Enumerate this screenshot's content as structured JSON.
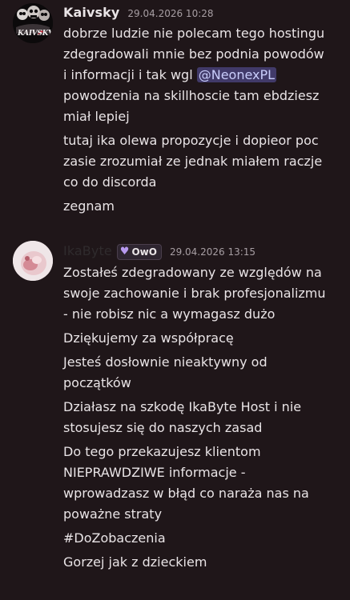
{
  "messages": [
    {
      "username": "Kaivsky",
      "timestamp": "29.04.2026 10:28",
      "avatar_icon": "skull-avatar-kaivsky",
      "avatar_text": "KAIVSKY",
      "paragraphs": [
        [
          "dobrze ludzie nie polecam tego hostingu",
          "zdegradowali mnie bez podnia powodów",
          "i informacji i tak wgl ",
          "powodzenia  na skillhoscie tam ebdziesz",
          "miał lepiej"
        ],
        [
          "tutaj ika olewa propozycje i dopieor poc",
          "zasie zrozumiał ze jednak miałem raczje",
          "co do discorda"
        ],
        [
          "zegnam"
        ]
      ],
      "mention": "@NeonexPL"
    },
    {
      "username": "IkaByte",
      "timestamp": "29.04.2026 13:15",
      "avatar_icon": "pink-avatar",
      "badge_icon": "heart-icon",
      "badge_label": "OwO",
      "paragraphs": [
        [
          "Zostałeś zdegradowany ze względów na",
          "swoje zachowanie i brak profesjonalizmu",
          "- nie robisz nic a wymagasz dużo"
        ],
        [
          "Dziękujemy za współpracę"
        ],
        [
          "Jesteś dosłownie nieaktywny od",
          "początków"
        ],
        [
          "Działasz na szkodę IkaByte Host i nie",
          "stosujesz się do naszych zasad"
        ],
        [
          "Do tego przekazujesz klientom",
          "NIEPRAWDZIWE informacje -",
          "wprowadzasz w błąd co naraża nas na",
          "poważne straty"
        ],
        [
          "#DoZobaczenia"
        ],
        [
          "Gorzej jak z dzieckiem"
        ]
      ]
    }
  ],
  "colors": {
    "background": "#1f1619",
    "text": "#e9e4e6",
    "timestamp": "#a79ea3",
    "mention_bg": "#413a69",
    "mention_text": "#c9cdfb",
    "ikabyte_name": "#2f2b2d"
  }
}
